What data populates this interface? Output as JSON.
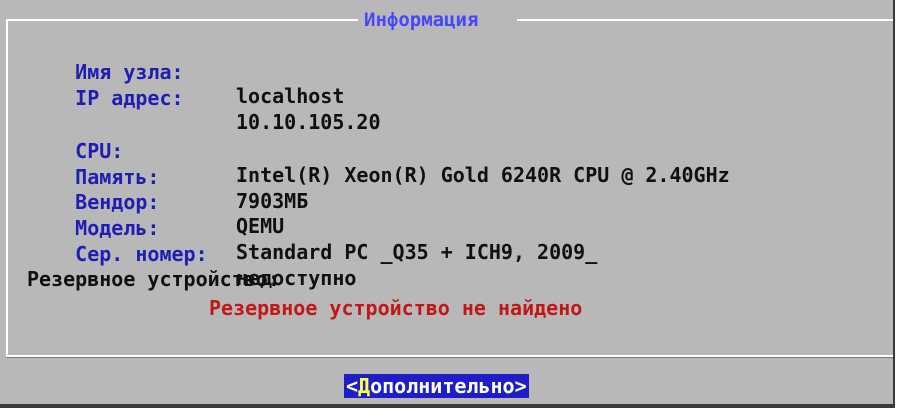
{
  "dialog": {
    "title": "Информация"
  },
  "info": {
    "hostname_label": "Имя узла:",
    "hostname_value": "localhost",
    "ip_label": "IP адрес:",
    "ip_value": "10.10.105.20",
    "cpu_label": "CPU:",
    "cpu_value": "Intel(R) Xeon(R) Gold 6240R CPU @ 2.40GHz",
    "memory_label": "Память:",
    "memory_value": "7903МБ",
    "vendor_label": "Вендор:",
    "vendor_value": "QEMU",
    "model_label": "Модель:",
    "model_value": "Standard PC _Q35 + ICH9, 2009_",
    "serial_label": "Сер. номер:",
    "serial_value": "недоступно"
  },
  "backup": {
    "label": "Резервное устройство:",
    "status": "Резервное устройство не найдено"
  },
  "buttons": {
    "more_open": "<",
    "more_label_first": "Д",
    "more_label_rest": "ополнительно",
    "more_close": ">"
  },
  "colors": {
    "background": "#b8b8b8",
    "title": "#4646ff",
    "label": "#1e1eb4",
    "value": "#101010",
    "warning": "#c01818",
    "button_bg": "#1e1ec8",
    "button_text": "#ffffff",
    "button_hotkey": "#ffff44"
  }
}
